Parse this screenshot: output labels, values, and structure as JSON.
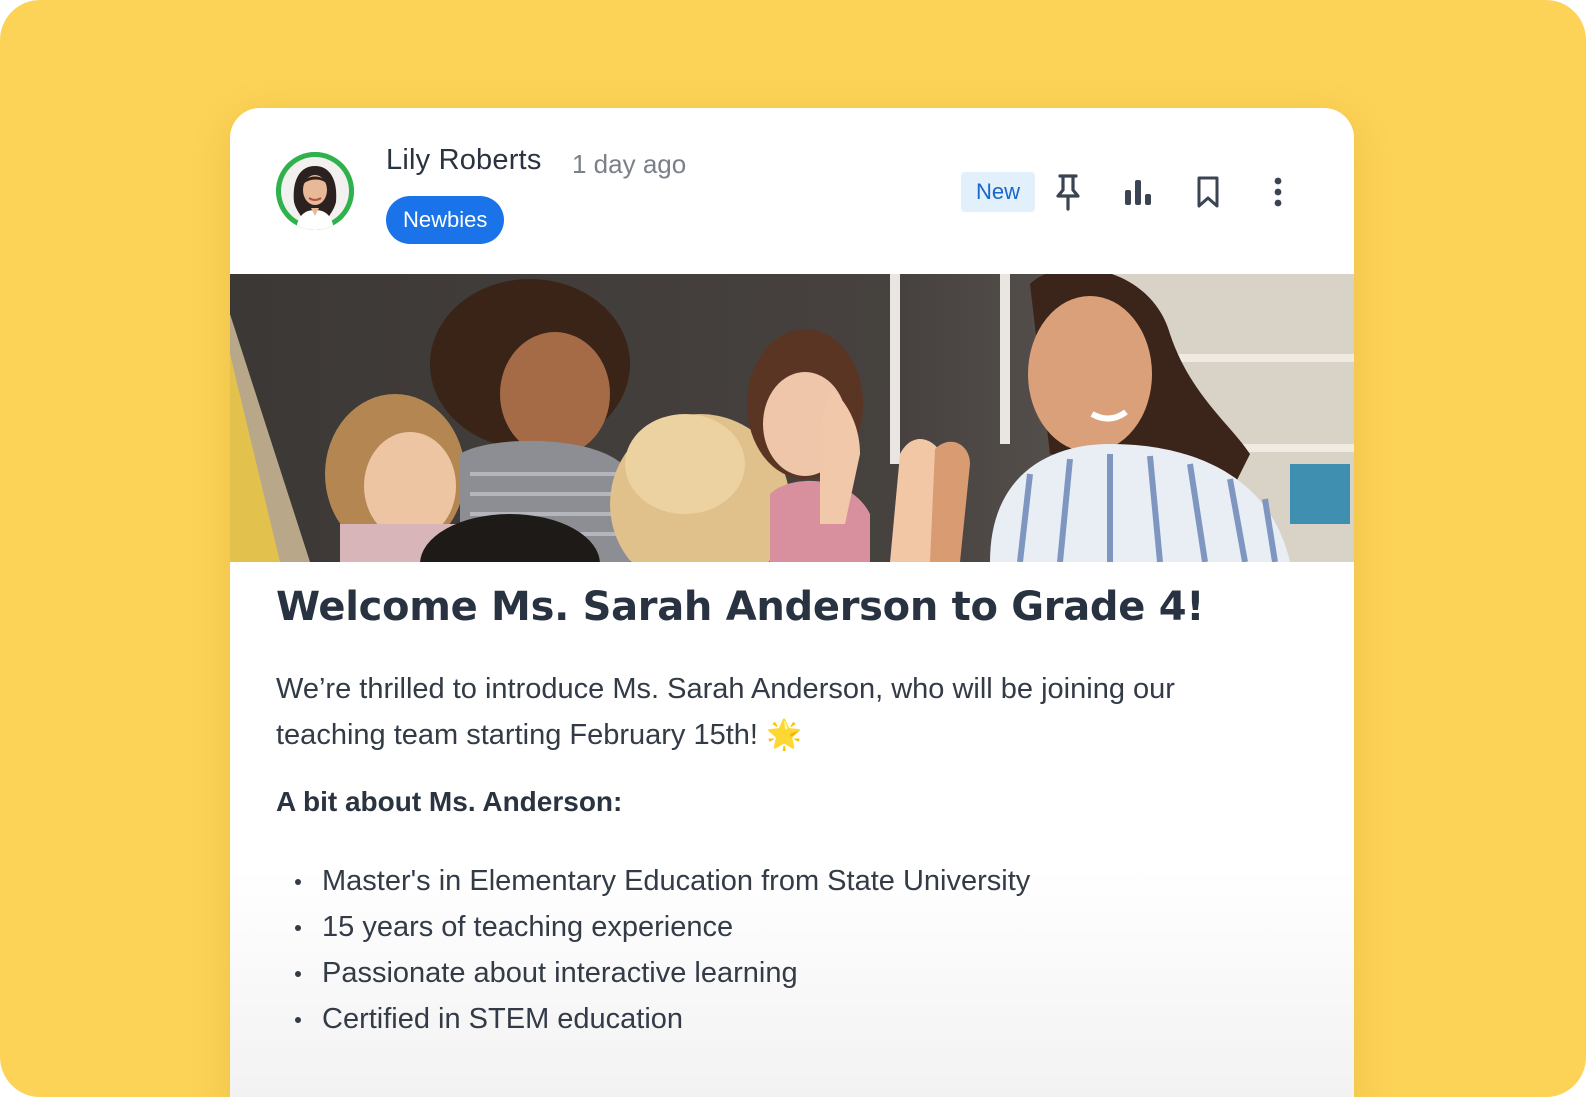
{
  "post": {
    "author_name": "Lily Roberts",
    "time_ago": "1 day ago",
    "group_tag": "Newbies",
    "status_badge": "New",
    "actions": [
      {
        "name": "pin",
        "icon": "pin-icon"
      },
      {
        "name": "analytics",
        "icon": "bar-chart-icon"
      },
      {
        "name": "bookmark",
        "icon": "bookmark-icon"
      },
      {
        "name": "more",
        "icon": "more-vertical-icon"
      }
    ],
    "title": "Welcome Ms. Sarah Anderson to Grade 4!",
    "intro": "We’re thrilled to introduce Ms. Sarah Anderson, who will be joining our teaching team starting February 15th! 🌟",
    "subheading": "A bit about Ms. Anderson:",
    "bullets": [
      "Master's in Elementary Education from State University",
      "15 years of teaching experience",
      "Passionate about interactive learning",
      "Certified in STEM education"
    ]
  },
  "colors": {
    "background": "#fcd257",
    "tag_blue": "#1a73e8",
    "badge_bg": "#e1f0fb",
    "badge_text": "#1967c8",
    "avatar_ring": "#2fb24c",
    "heading": "#283241"
  }
}
